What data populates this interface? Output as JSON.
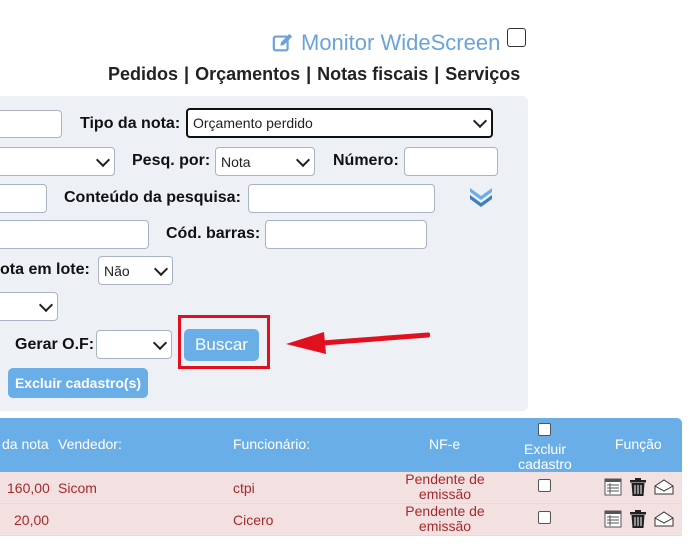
{
  "header": {
    "monitor_label": "Monitor WideScreen",
    "nav": [
      "Pedidos",
      "Orçamentos",
      "Notas fiscais",
      "Serviços"
    ],
    "nav_separator": "|"
  },
  "filters": {
    "tipo_nota_label": "Tipo da nota:",
    "tipo_nota_value": "Orçamento perdido",
    "pesq_por_label": "Pesq. por:",
    "pesq_por_value": "Nota",
    "numero_label": "Número:",
    "conteudo_label": "Conteúdo da pesquisa:",
    "cod_barras_label": "Cód. barras:",
    "nota_lote_label": "ota em lote:",
    "nota_lote_value": "Não",
    "gerar_of_label": "Gerar O.F:",
    "buscar_label": "Buscar",
    "excluir_label": "Excluir cadastro(s)"
  },
  "table": {
    "headers": {
      "valor": "da nota",
      "vendedor": "Vendedor:",
      "funcionario": "Funcionário:",
      "nfe": "NF-e",
      "excluir": "Excluir cadastro",
      "funcao": "Função"
    },
    "rows": [
      {
        "valor": "160,00",
        "vendedor": "Sicom",
        "funcionario": "ctpi",
        "nfe": "Pendente de emissão"
      },
      {
        "valor": "20,00",
        "vendedor": "",
        "funcionario": "Cicero",
        "nfe": "Pendente de emissão"
      }
    ]
  },
  "colors": {
    "accent": "#6aaee8",
    "highlight": "#e0101e",
    "row_bg": "#f3e1e2",
    "row_text": "#a52a2a"
  }
}
